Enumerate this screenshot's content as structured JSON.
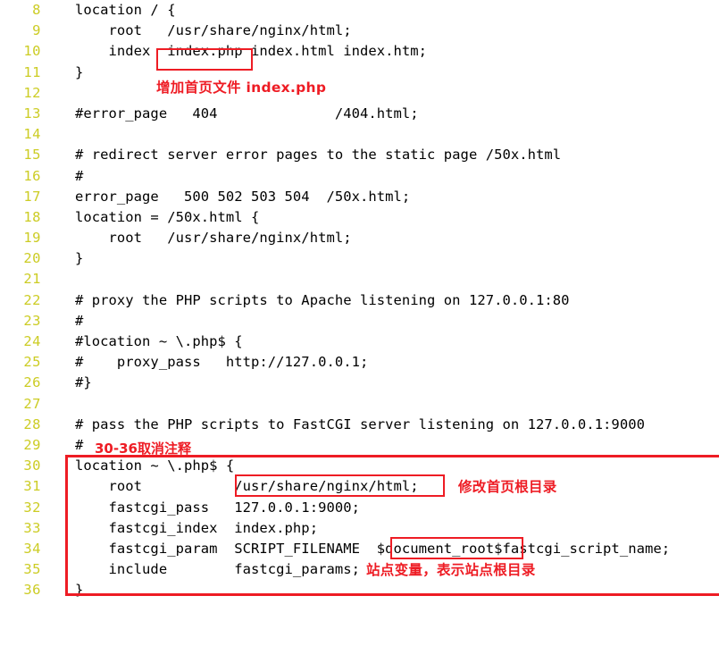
{
  "editor": {
    "kind": "nginx-config-code-listing",
    "gutter_color": "#cccc24",
    "text_color": "#000000",
    "background": "#ffffff",
    "annotation_color": "#ee1c24",
    "first_line_number": 8,
    "last_line_number": 36
  },
  "lines": [
    {
      "num": "8",
      "text": "location / {"
    },
    {
      "num": "9",
      "text": "    root   /usr/share/nginx/html;"
    },
    {
      "num": "10",
      "text": "    index  index.php index.html index.htm;"
    },
    {
      "num": "11",
      "text": "}"
    },
    {
      "num": "12",
      "text": ""
    },
    {
      "num": "13",
      "text": "#error_page   404              /404.html;"
    },
    {
      "num": "14",
      "text": ""
    },
    {
      "num": "15",
      "text": "# redirect server error pages to the static page /50x.html"
    },
    {
      "num": "16",
      "text": "#"
    },
    {
      "num": "17",
      "text": "error_page   500 502 503 504  /50x.html;"
    },
    {
      "num": "18",
      "text": "location = /50x.html {"
    },
    {
      "num": "19",
      "text": "    root   /usr/share/nginx/html;"
    },
    {
      "num": "20",
      "text": "}"
    },
    {
      "num": "21",
      "text": ""
    },
    {
      "num": "22",
      "text": "# proxy the PHP scripts to Apache listening on 127.0.0.1:80"
    },
    {
      "num": "23",
      "text": "#"
    },
    {
      "num": "24",
      "text": "#location ~ \\.php$ {"
    },
    {
      "num": "25",
      "text": "#    proxy_pass   http://127.0.0.1;"
    },
    {
      "num": "26",
      "text": "#}"
    },
    {
      "num": "27",
      "text": ""
    },
    {
      "num": "28",
      "text": "# pass the PHP scripts to FastCGI server listening on 127.0.0.1:9000"
    },
    {
      "num": "29",
      "text": "# "
    },
    {
      "num": "30",
      "text": "location ~ \\.php$ {"
    },
    {
      "num": "31",
      "text": "    root           /usr/share/nginx/html;"
    },
    {
      "num": "32",
      "text": "    fastcgi_pass   127.0.0.1:9000;"
    },
    {
      "num": "33",
      "text": "    fastcgi_index  index.php;"
    },
    {
      "num": "34",
      "text": "    fastcgi_param  SCRIPT_FILENAME  $document_root$fastcgi_script_name;"
    },
    {
      "num": "35",
      "text": "    include        fastcgi_params;"
    },
    {
      "num": "36",
      "text": "}"
    }
  ],
  "annotations": {
    "index_php_note": "增加首页文件 index.php",
    "uncomment_note": "30-36取消注释",
    "root_dir_note": "修改首页根目录",
    "document_root_note": "站点变量，表示站点根目录"
  }
}
